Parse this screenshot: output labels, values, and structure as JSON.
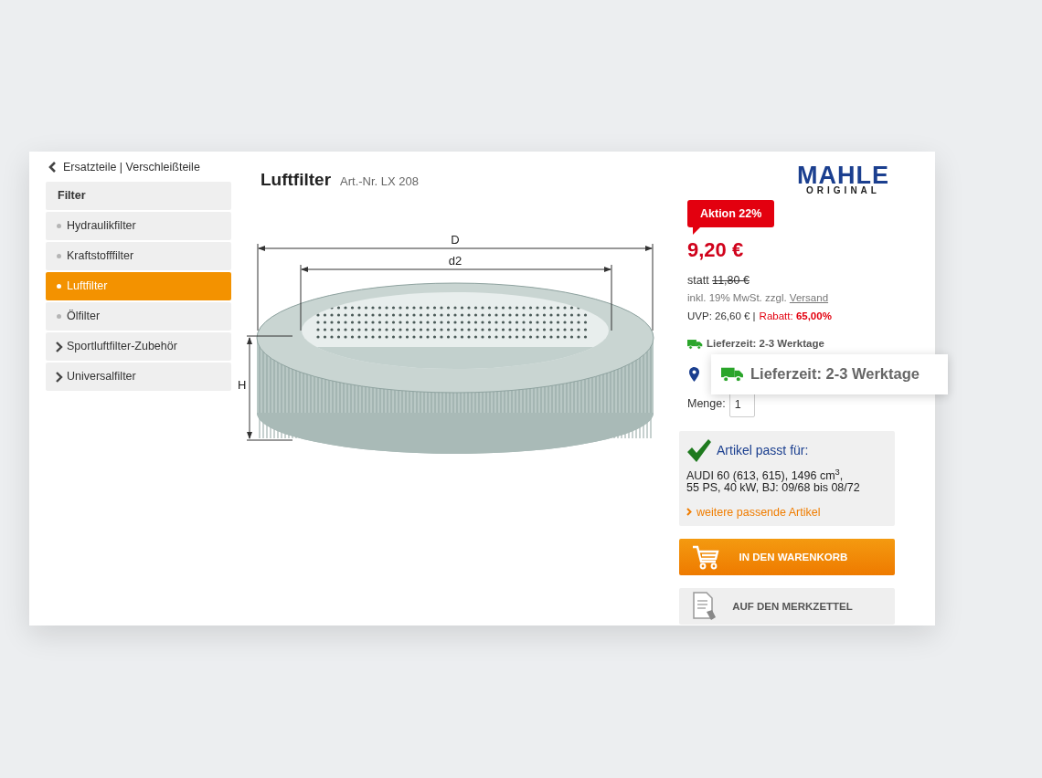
{
  "breadcrumb": "Ersatzteile | Verschleißteile",
  "sidebar": {
    "header": "Filter",
    "items": [
      {
        "label": "Hydraulikfilter",
        "kind": "bullet",
        "selected": false
      },
      {
        "label": "Kraftstofffilter",
        "kind": "bullet",
        "selected": false
      },
      {
        "label": "Luftfilter",
        "kind": "bullet",
        "selected": true
      },
      {
        "label": "Ölfilter",
        "kind": "bullet",
        "selected": false
      },
      {
        "label": "Sportluftfilter-Zubehör",
        "kind": "arrow",
        "selected": false
      },
      {
        "label": "Universalfilter",
        "kind": "arrow",
        "selected": false
      }
    ]
  },
  "product": {
    "title": "Luftfilter",
    "article_number": "Art.-Nr. LX 208",
    "image_labels": [
      "D",
      "d2",
      "H"
    ]
  },
  "brand_logo": {
    "name": "MAHLE",
    "subtitle": "ORIGINAL"
  },
  "price": {
    "badge": "Aktion 22%",
    "current": "9,20 €",
    "was_prefix": "statt",
    "was": "11,80 €",
    "tax_note": "inkl. 19% MwSt. zzgl.",
    "shipping_link": "Versand",
    "rrp": "UVP: 26,60 € |",
    "discount": "Rabatt: **65,00%**"
  },
  "delivery": "Lieferzeit: 2-3 Werktage",
  "delivery_callout": "Lieferzeit: 2-3 Werktage",
  "quantity": {
    "label": "Menge:",
    "value": "1"
  },
  "fitment": {
    "title": "Artikel passt für:",
    "vehicle_lines": [
      "AUDI 60 (613, 615), 1496 cm$^{3}$,",
      "55 PS, 40 kW, BJ: 09/68 bis 08/72"
    ],
    "more_link": "weitere passende Artikel"
  },
  "buttons": [
    {
      "label": "IN DEN WARENKORB",
      "kind": "cart"
    },
    {
      "label": "AUF DEN MERKZETTEL",
      "kind": "wishlist"
    }
  ]
}
